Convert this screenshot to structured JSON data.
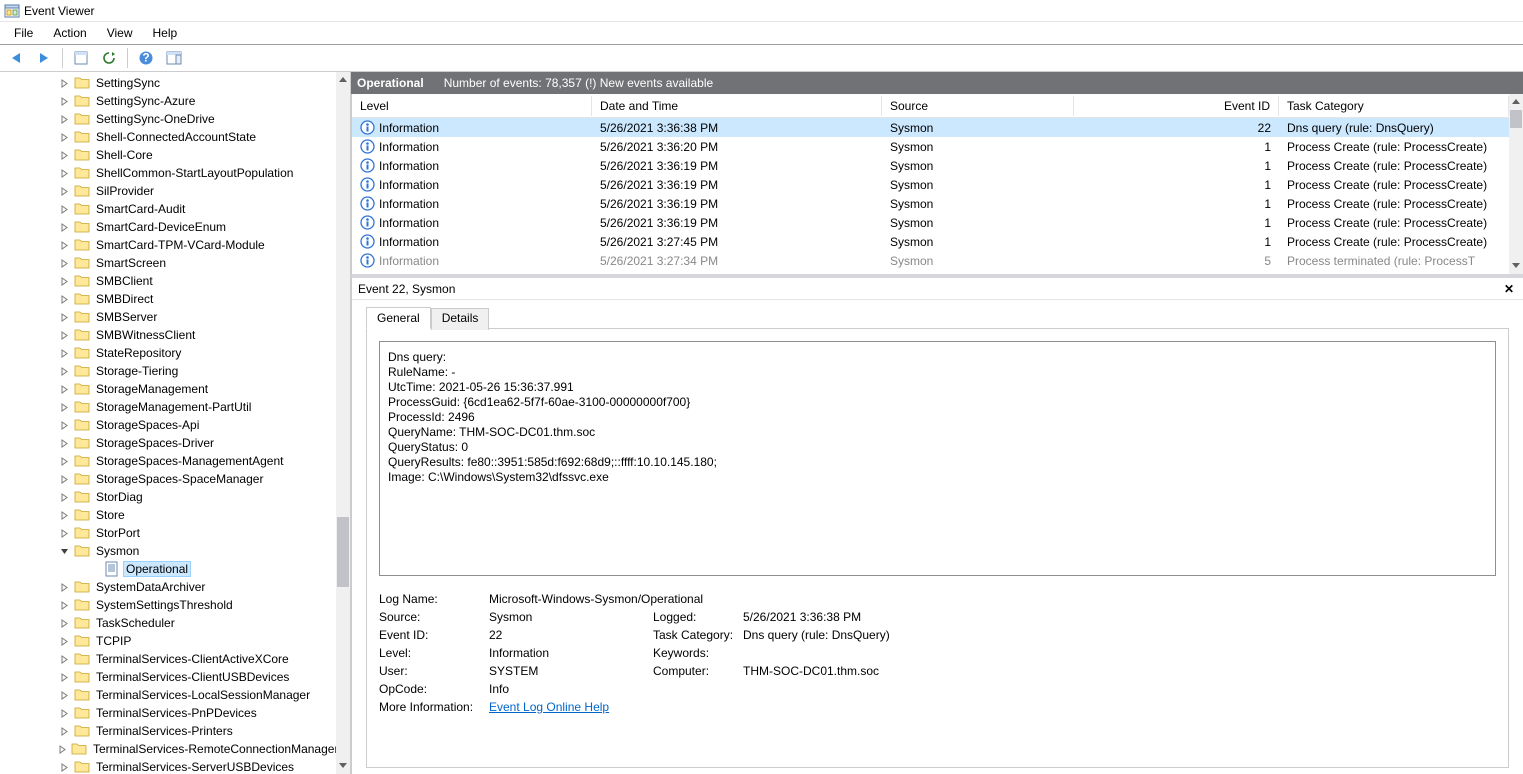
{
  "app_title": "Event Viewer",
  "menu": {
    "file": "File",
    "action": "Action",
    "view": "View",
    "help": "Help"
  },
  "tree_items": [
    {
      "label": "SettingSync",
      "type": "folder",
      "arrow": ">"
    },
    {
      "label": "SettingSync-Azure",
      "type": "folder",
      "arrow": ">"
    },
    {
      "label": "SettingSync-OneDrive",
      "type": "folder",
      "arrow": ">"
    },
    {
      "label": "Shell-ConnectedAccountState",
      "type": "folder",
      "arrow": ">"
    },
    {
      "label": "Shell-Core",
      "type": "folder",
      "arrow": ">"
    },
    {
      "label": "ShellCommon-StartLayoutPopulation",
      "type": "folder",
      "arrow": ">"
    },
    {
      "label": "SilProvider",
      "type": "folder",
      "arrow": ">"
    },
    {
      "label": "SmartCard-Audit",
      "type": "folder",
      "arrow": ">"
    },
    {
      "label": "SmartCard-DeviceEnum",
      "type": "folder",
      "arrow": ">"
    },
    {
      "label": "SmartCard-TPM-VCard-Module",
      "type": "folder",
      "arrow": ">"
    },
    {
      "label": "SmartScreen",
      "type": "folder",
      "arrow": ">"
    },
    {
      "label": "SMBClient",
      "type": "folder",
      "arrow": ">"
    },
    {
      "label": "SMBDirect",
      "type": "folder",
      "arrow": ">"
    },
    {
      "label": "SMBServer",
      "type": "folder",
      "arrow": ">"
    },
    {
      "label": "SMBWitnessClient",
      "type": "folder",
      "arrow": ">"
    },
    {
      "label": "StateRepository",
      "type": "folder",
      "arrow": ">"
    },
    {
      "label": "Storage-Tiering",
      "type": "folder",
      "arrow": ">"
    },
    {
      "label": "StorageManagement",
      "type": "folder",
      "arrow": ">"
    },
    {
      "label": "StorageManagement-PartUtil",
      "type": "folder",
      "arrow": ">"
    },
    {
      "label": "StorageSpaces-Api",
      "type": "folder",
      "arrow": ">"
    },
    {
      "label": "StorageSpaces-Driver",
      "type": "folder",
      "arrow": ">"
    },
    {
      "label": "StorageSpaces-ManagementAgent",
      "type": "folder",
      "arrow": ">"
    },
    {
      "label": "StorageSpaces-SpaceManager",
      "type": "folder",
      "arrow": ">"
    },
    {
      "label": "StorDiag",
      "type": "folder",
      "arrow": ">"
    },
    {
      "label": "Store",
      "type": "folder",
      "arrow": ">"
    },
    {
      "label": "StorPort",
      "type": "folder",
      "arrow": ">"
    },
    {
      "label": "Sysmon",
      "type": "folder",
      "arrow": "v"
    },
    {
      "label": "Operational",
      "type": "log",
      "selected": true,
      "child": true
    },
    {
      "label": "SystemDataArchiver",
      "type": "folder",
      "arrow": ">"
    },
    {
      "label": "SystemSettingsThreshold",
      "type": "folder",
      "arrow": ">"
    },
    {
      "label": "TaskScheduler",
      "type": "folder",
      "arrow": ">"
    },
    {
      "label": "TCPIP",
      "type": "folder",
      "arrow": ">"
    },
    {
      "label": "TerminalServices-ClientActiveXCore",
      "type": "folder",
      "arrow": ">"
    },
    {
      "label": "TerminalServices-ClientUSBDevices",
      "type": "folder",
      "arrow": ">"
    },
    {
      "label": "TerminalServices-LocalSessionManager",
      "type": "folder",
      "arrow": ">"
    },
    {
      "label": "TerminalServices-PnPDevices",
      "type": "folder",
      "arrow": ">"
    },
    {
      "label": "TerminalServices-Printers",
      "type": "folder",
      "arrow": ">"
    },
    {
      "label": "TerminalServices-RemoteConnectionManager",
      "type": "folder",
      "arrow": ">"
    },
    {
      "label": "TerminalServices-ServerUSBDevices",
      "type": "folder",
      "arrow": ">"
    }
  ],
  "pane_header": {
    "title": "Operational",
    "subtitle": "Number of events: 78,357 (!) New events available"
  },
  "grid_header": {
    "level": "Level",
    "date": "Date and Time",
    "source": "Source",
    "eid": "Event ID",
    "cat": "Task Category"
  },
  "events": [
    {
      "level": "Information",
      "date": "5/26/2021 3:36:38 PM",
      "source": "Sysmon",
      "eid": "22",
      "cat": "Dns query (rule: DnsQuery)",
      "sel": true
    },
    {
      "level": "Information",
      "date": "5/26/2021 3:36:20 PM",
      "source": "Sysmon",
      "eid": "1",
      "cat": "Process Create (rule: ProcessCreate)"
    },
    {
      "level": "Information",
      "date": "5/26/2021 3:36:19 PM",
      "source": "Sysmon",
      "eid": "1",
      "cat": "Process Create (rule: ProcessCreate)"
    },
    {
      "level": "Information",
      "date": "5/26/2021 3:36:19 PM",
      "source": "Sysmon",
      "eid": "1",
      "cat": "Process Create (rule: ProcessCreate)"
    },
    {
      "level": "Information",
      "date": "5/26/2021 3:36:19 PM",
      "source": "Sysmon",
      "eid": "1",
      "cat": "Process Create (rule: ProcessCreate)"
    },
    {
      "level": "Information",
      "date": "5/26/2021 3:36:19 PM",
      "source": "Sysmon",
      "eid": "1",
      "cat": "Process Create (rule: ProcessCreate)"
    },
    {
      "level": "Information",
      "date": "5/26/2021 3:27:45 PM",
      "source": "Sysmon",
      "eid": "1",
      "cat": "Process Create (rule: ProcessCreate)"
    },
    {
      "level": "Information",
      "date": "5/26/2021 3:27:34 PM",
      "source": "Sysmon",
      "eid": "5",
      "cat": "Process terminated (rule: ProcessT",
      "partial": true
    }
  ],
  "detail_header": "Event 22, Sysmon",
  "tabs": {
    "general": "General",
    "details": "Details"
  },
  "event_body": "Dns query:\nRuleName: -\nUtcTime: 2021-05-26 15:36:37.991\nProcessGuid: {6cd1ea62-5f7f-60ae-3100-00000000f700}\nProcessId: 2496\nQueryName: THM-SOC-DC01.thm.soc\nQueryStatus: 0\nQueryResults: fe80::3951:585d:f692:68d9;::ffff:10.10.145.180;\nImage: C:\\Windows\\System32\\dfssvc.exe",
  "meta": {
    "log_name_l": "Log Name:",
    "log_name_v": "Microsoft-Windows-Sysmon/Operational",
    "source_l": "Source:",
    "source_v": "Sysmon",
    "logged_l": "Logged:",
    "logged_v": "5/26/2021 3:36:38 PM",
    "eid_l": "Event ID:",
    "eid_v": "22",
    "task_l": "Task Category:",
    "task_v": "Dns query (rule: DnsQuery)",
    "level_l": "Level:",
    "level_v": "Information",
    "keywords_l": "Keywords:",
    "keywords_v": "",
    "user_l": "User:",
    "user_v": "SYSTEM",
    "computer_l": "Computer:",
    "computer_v": "THM-SOC-DC01.thm.soc",
    "opcode_l": "OpCode:",
    "opcode_v": "Info",
    "more_l": "More Information:",
    "more_link": "Event Log Online Help"
  }
}
